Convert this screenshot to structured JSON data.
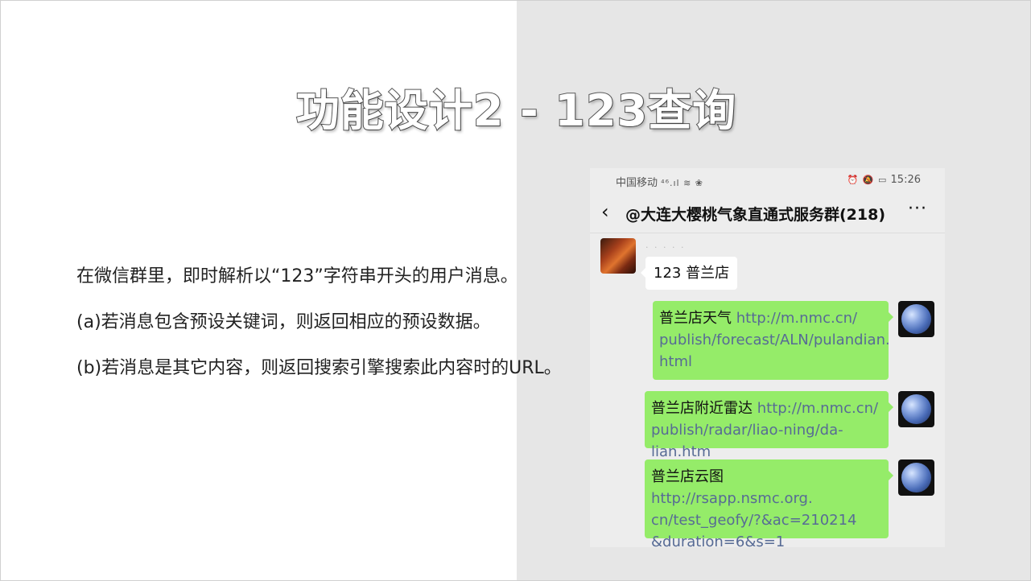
{
  "slide": {
    "title": "功能设计2 - 123查询",
    "bullets": [
      "在微信群里，即时解析以“123”字符串开头的用户消息。",
      "(a)若消息包含预设关键词，则返回相应的预设数据。",
      "(b)若消息是其它内容，则返回搜索引擎搜索此内容时的URL。"
    ]
  },
  "phone": {
    "status": {
      "carrier": "中国移动",
      "left_icons": "⁴⁶.ıl ≋ ❀",
      "right_icons": "⏰ 🔕 ▭",
      "time": "15:26"
    },
    "nav": {
      "back": "‹",
      "title": "@大连大樱桃气象直通式服务群(218)",
      "more": "···"
    },
    "messages": {
      "incoming": {
        "sender": "· · · · ·",
        "text": "123 普兰店"
      },
      "replies": [
        {
          "name": "普兰店天气",
          "url": "http://m.nmc.cn/publish/forecast/ALN/pulandian.html",
          "lines": [
            "http://m.nmc.cn/",
            "publish/forecast/ALN/pulandian.",
            "html"
          ]
        },
        {
          "name": "普兰店附近雷达",
          "url": "http://m.nmc.cn/publish/radar/liao-ning/da-lian.htm",
          "lines": [
            "http://m.nmc.cn/",
            "publish/radar/liao-ning/da-lian.htm"
          ]
        },
        {
          "name": "普兰店云图",
          "url": "http://rsapp.nsmc.org.cn/test_geofy/?&ac=210214&duration=6&s=1",
          "lines": [
            "http://rsapp.nsmc.org.",
            "cn/test_geofy/?&ac=210214",
            "&duration=6&s=1"
          ]
        }
      ]
    }
  }
}
